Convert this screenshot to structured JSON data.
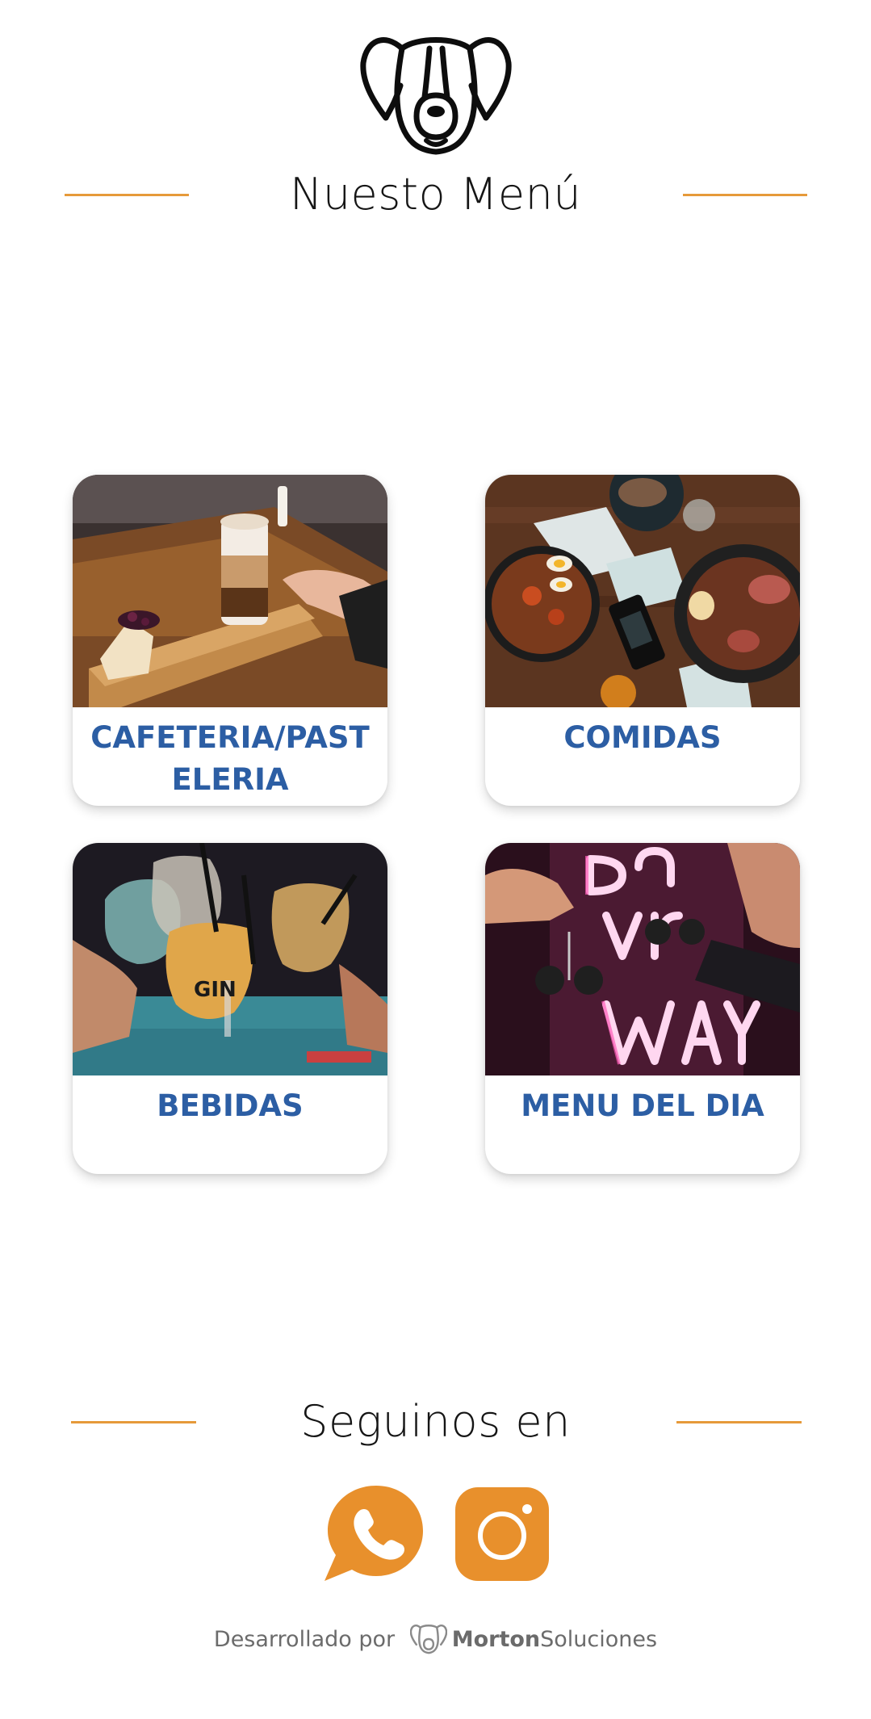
{
  "header": {
    "logo_icon": "dog-head-icon",
    "title": "Nuesto Menú"
  },
  "categories": [
    {
      "label": "CAFETERIA/PASTELERIA",
      "image": "coffee-cheesecake-photo"
    },
    {
      "label": "COMIDAS",
      "image": "food-table-photo"
    },
    {
      "label": "BEBIDAS",
      "image": "gin-toast-photo"
    },
    {
      "label": "MENU DEL DIA",
      "image": "neon-sign-photo"
    }
  ],
  "social": {
    "title": "Seguinos en",
    "buttons": [
      {
        "icon": "whatsapp-icon"
      },
      {
        "icon": "instagram-icon"
      }
    ]
  },
  "footer": {
    "prefix": "Desarrollado por",
    "brand_bold": "Morton",
    "brand_light": "Soluciones",
    "logo_icon": "dog-head-icon"
  },
  "colors": {
    "accent": "#e69a3a",
    "label_blue": "#2c5ea4",
    "social_orange": "#e8902c"
  }
}
